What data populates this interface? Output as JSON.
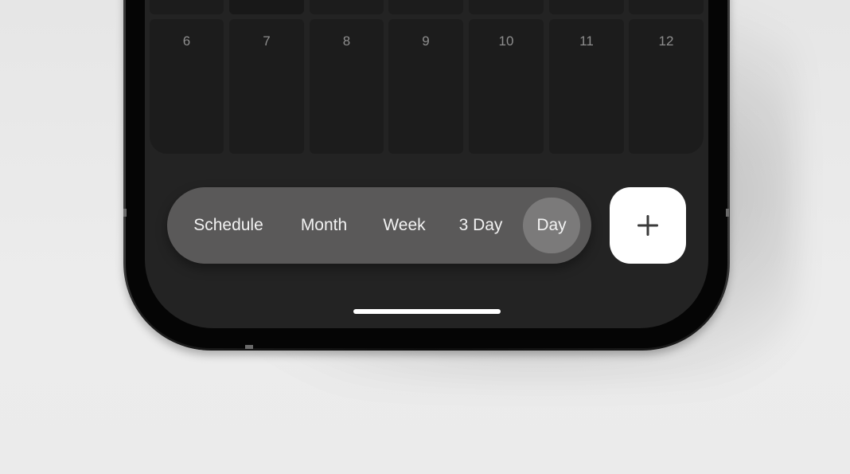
{
  "calendar": {
    "days": [
      "6",
      "7",
      "8",
      "9",
      "10",
      "11",
      "12"
    ]
  },
  "view_switcher": {
    "options": [
      "Schedule",
      "Month",
      "Week",
      "3 Day",
      "Day"
    ],
    "selected": "Day"
  },
  "fab": {
    "icon": "plus-icon"
  },
  "colors": {
    "screen_bg": "#232323",
    "cell_bg": "#1c1c1c",
    "switcher_bg": "#5a5959",
    "active_bg": "#7b7a7a",
    "fab_bg": "#ffffff",
    "page_bg": "#ebebeb"
  }
}
